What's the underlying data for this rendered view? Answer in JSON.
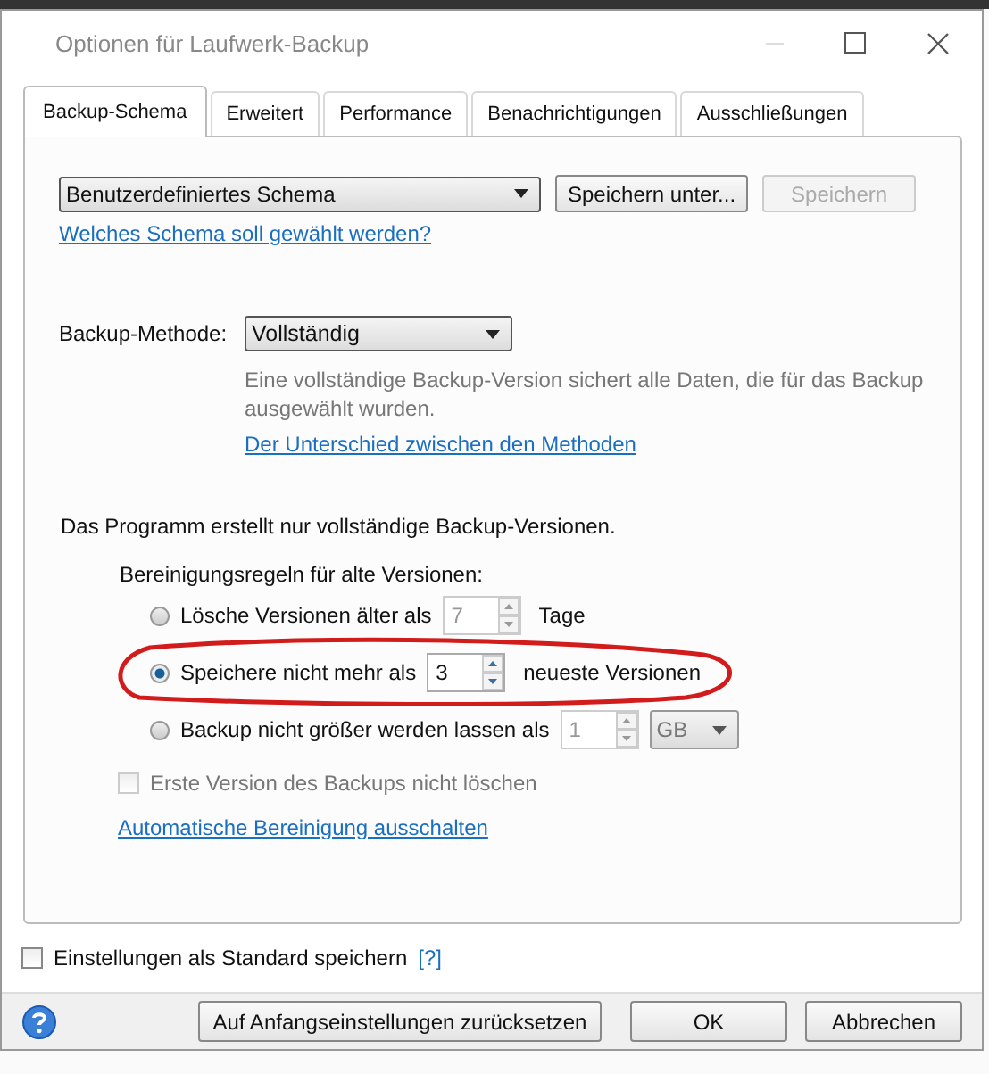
{
  "window": {
    "title": "Optionen für Laufwerk-Backup"
  },
  "tabs": [
    {
      "label": "Backup-Schema",
      "selected": true
    },
    {
      "label": "Erweitert",
      "selected": false
    },
    {
      "label": "Performance",
      "selected": false
    },
    {
      "label": "Benachrichtigungen",
      "selected": false
    },
    {
      "label": "Ausschließungen",
      "selected": false
    }
  ],
  "scheme": {
    "value": "Benutzerdefiniertes Schema",
    "buttons": [
      {
        "label": "Speichern unter...",
        "disabled": false
      },
      {
        "label": "Speichern",
        "disabled": true
      }
    ],
    "help_link": "Welches Schema soll gewählt werden?"
  },
  "method": {
    "label": "Backup-Methode:",
    "value": "Vollständig",
    "description": "Eine vollständige Backup-Version sichert alle Daten, die für das Backup ausgewählt wurden.",
    "link": "Der Unterschied zwischen den Methoden"
  },
  "info": "Das Programm erstellt nur vollständige Backup-Versionen.",
  "cleanup": {
    "title": "Bereinigungsregeln für alte Versionen:",
    "rules": [
      {
        "label": "Lösche Versionen älter als",
        "value": "7",
        "unit": "Tage",
        "kind": "text",
        "selected": false,
        "circled": false
      },
      {
        "label": "Speichere nicht mehr als",
        "value": "3",
        "unit": "neueste Versionen",
        "kind": "text",
        "selected": true,
        "circled": true
      },
      {
        "label": "Backup nicht größer werden lassen als",
        "value": "1",
        "unit": "GB",
        "kind": "dropdown",
        "selected": false,
        "circled": false
      }
    ],
    "keep_first": {
      "label": "Erste Version des Backups nicht löschen",
      "checked": false,
      "disabled": true
    },
    "disable_link": "Automatische Bereinigung ausschalten"
  },
  "save_default": {
    "label": "Einstellungen als Standard speichern",
    "checked": false,
    "help": "[?]"
  },
  "buttons": [
    "Auf Anfangseinstellungen zurücksetzen",
    "OK",
    "Abbrechen"
  ]
}
